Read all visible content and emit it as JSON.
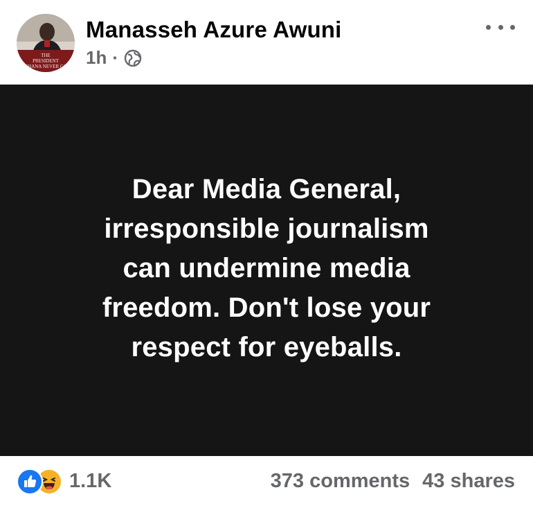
{
  "post": {
    "author": {
      "name": "Manasseh Azure Awuni",
      "avatar_caption_lines": [
        "THE",
        "PRESIDENT",
        "GHANA NEVER GO"
      ]
    },
    "meta": {
      "timestamp": "1h",
      "separator": "·",
      "audience_icon": "globe-icon"
    },
    "more_icon": "more-options-icon",
    "message_lines": [
      "Dear Media General,",
      "irresponsible journalism",
      "can undermine media",
      "freedom. Don't lose your",
      "respect for eyeballs."
    ],
    "background_color": "#151515",
    "text_color": "#ffffff"
  },
  "footer": {
    "reaction_icons": [
      "like-icon",
      "haha-icon"
    ],
    "reaction_count": "1.1K",
    "comments": "373 comments",
    "shares": "43 shares"
  },
  "colors": {
    "like_blue": "#1877f2",
    "haha_yellow": "#f7b125",
    "secondary_text": "#65676b"
  }
}
